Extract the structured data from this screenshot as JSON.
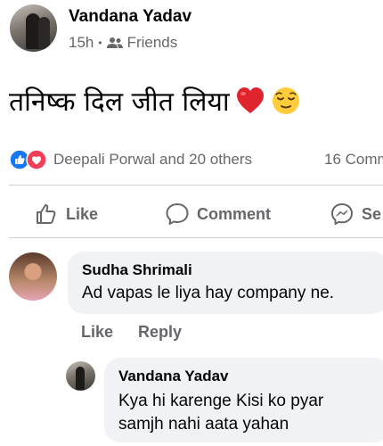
{
  "post": {
    "author": "Vandana Yadav",
    "time": "15h",
    "audience": "Friends",
    "text": "तनिष्क दिल जीत लिया",
    "emojis": [
      "heart-emoji",
      "relieved-face-emoji"
    ],
    "reactions_summary": "Deepali Porwal and 20 others",
    "comments_count": "16 Comm"
  },
  "actions": {
    "like": "Like",
    "comment": "Comment",
    "share": "Se"
  },
  "comments": [
    {
      "author": "Sudha Shrimali",
      "text": "Ad vapas le liya hay company ne.",
      "like_label": "Like",
      "reply_label": "Reply"
    },
    {
      "author": "Vandana Yadav",
      "text": "Kya hi karenge Kisi ko pyar samjh nahi aata yahan"
    }
  ],
  "colors": {
    "secondary_text": "#65676b",
    "bubble": "#f0f2f5",
    "like_blue": "#1877f2",
    "love_red": "#f33e58"
  }
}
